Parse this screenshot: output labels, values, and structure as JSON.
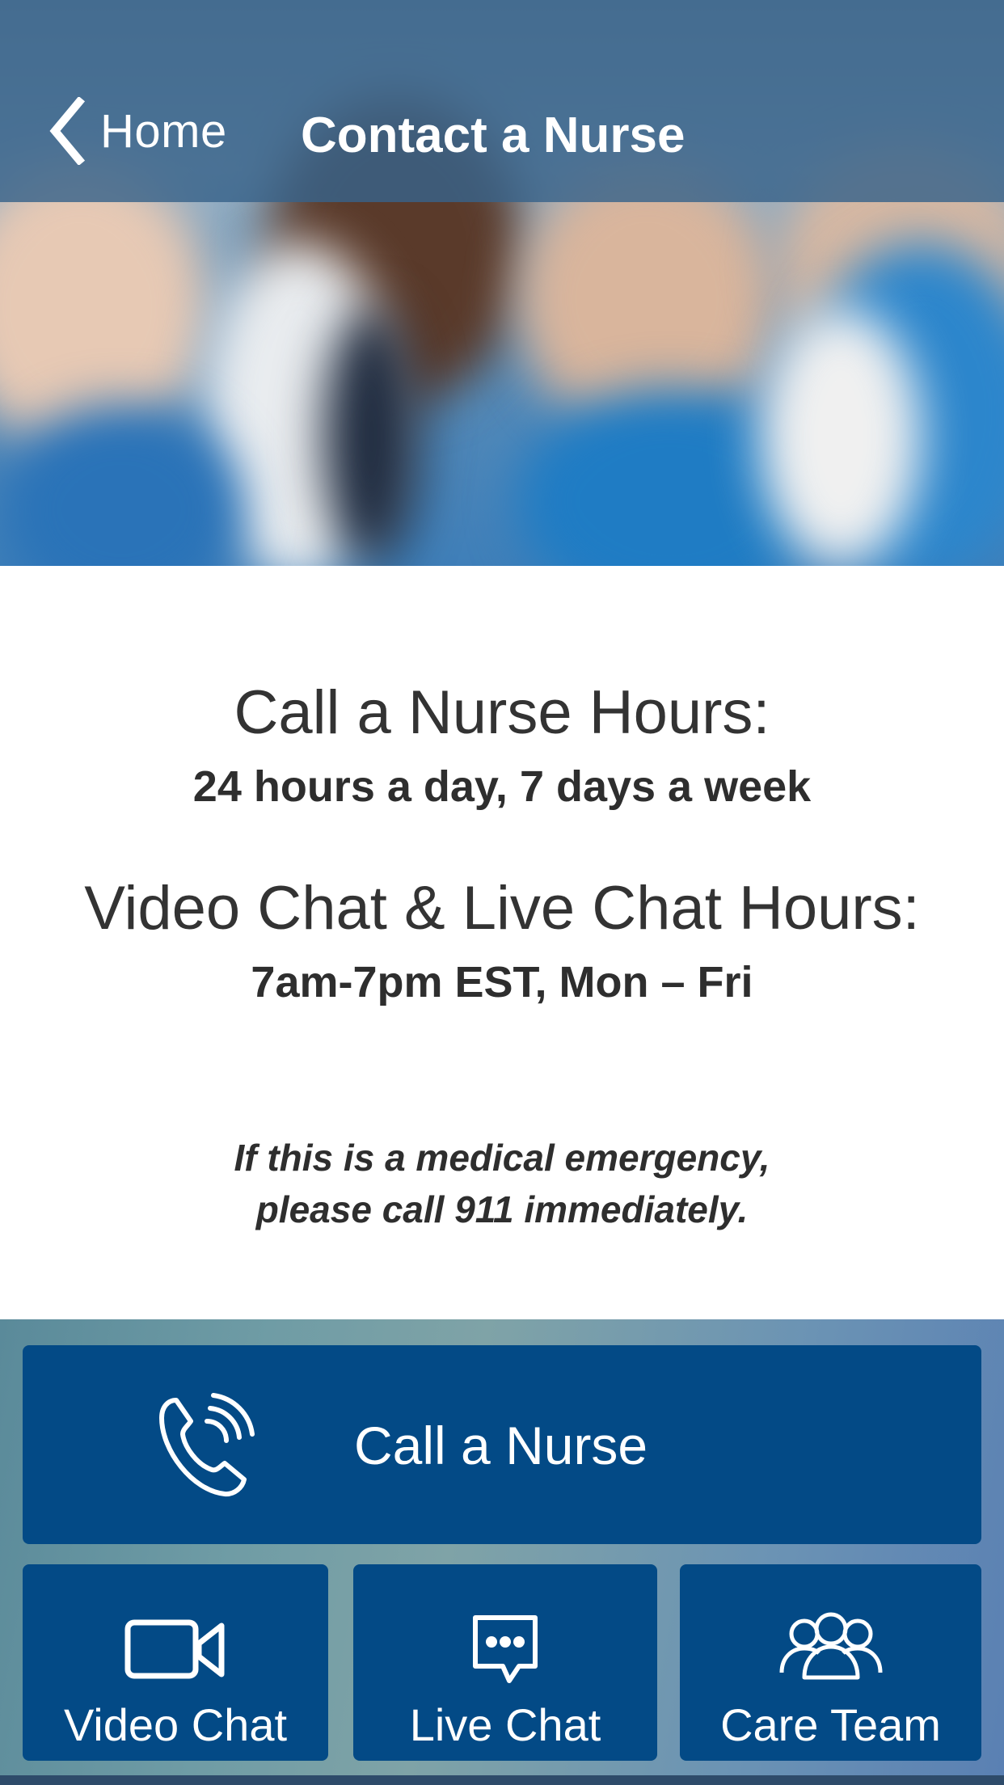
{
  "nav": {
    "back_label": "Home",
    "title": "Contact a Nurse"
  },
  "info": {
    "call_hours_title": "Call a Nurse Hours:",
    "call_hours_value": "24 hours a day, 7 days a week",
    "chat_hours_title": "Video Chat & Live Chat Hours:",
    "chat_hours_value": "7am-7pm EST, Mon – Fri",
    "emergency_line1": "If this is a medical emergency,",
    "emergency_line2": "please call 911 immediately."
  },
  "actions": {
    "call": {
      "label": "Call a Nurse",
      "icon": "phone-ringing-icon"
    },
    "video": {
      "label": "Video Chat",
      "icon": "video-camera-icon"
    },
    "live": {
      "label": "Live Chat",
      "icon": "chat-bubble-icon"
    },
    "care": {
      "label": "Care Team",
      "icon": "people-group-icon"
    }
  },
  "colors": {
    "button_bg": "#034a86",
    "nav_bg": "#38638a",
    "text_dark": "#2e2e2e"
  }
}
